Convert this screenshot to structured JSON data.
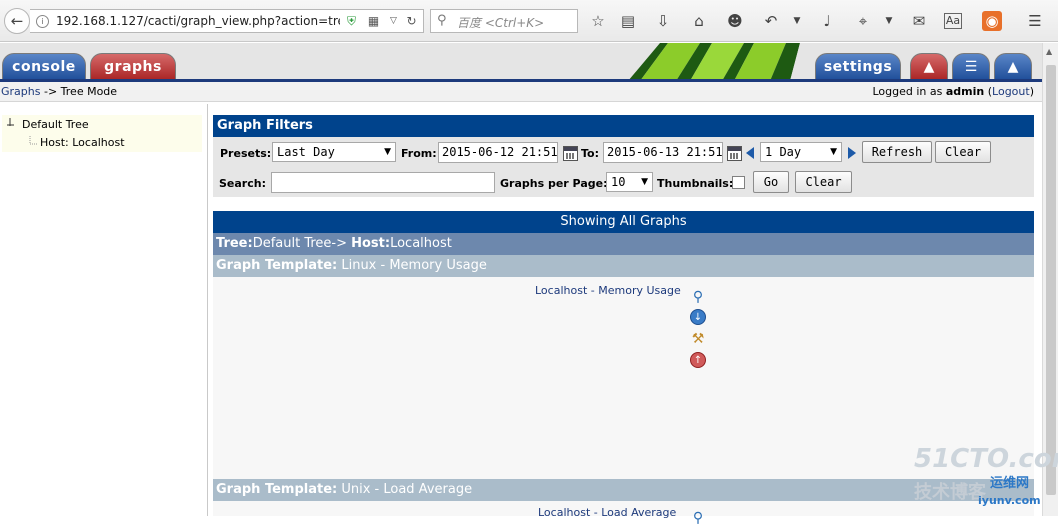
{
  "browser": {
    "url": "192.168.1.127/cacti/graph_view.php?action=tree&",
    "search_placeholder": "百度 <Ctrl+K>"
  },
  "tabs": {
    "console": "console",
    "graphs": "graphs",
    "settings": "settings"
  },
  "breadcrumb": {
    "root": "Graphs",
    "separator": " -> ",
    "current": "Tree Mode"
  },
  "login": {
    "prefix": "Logged in as ",
    "user": "admin",
    "open": " (",
    "logout": "Logout",
    "close": ")"
  },
  "tree": {
    "items": [
      {
        "label": "Default Tree"
      },
      {
        "label": "Host: Localhost"
      }
    ]
  },
  "filters": {
    "title": "Graph Filters",
    "presets_label": "Presets:",
    "presets_value": "Last Day",
    "from_label": "From:",
    "from_value": "2015-06-12 21:51",
    "to_label": "To:",
    "to_value": "2015-06-13 21:51",
    "timespan_value": "1 Day",
    "refresh": "Refresh",
    "clear": "Clear",
    "search_label": "Search:",
    "search_value": "",
    "per_page_label": "Graphs per Page:",
    "per_page_value": "10",
    "thumbnails_label": "Thumbnails:",
    "go": "Go",
    "clear2": "Clear"
  },
  "results": {
    "showing": "Showing All Graphs",
    "tree_key": "Tree:",
    "tree_value": "Default Tree",
    "host_sep": "-> ",
    "host_key": "Host:",
    "host_value": "Localhost",
    "templates": [
      {
        "key": "Graph Template:",
        "value": " Linux - Memory Usage",
        "graph_host": "Localhost",
        "graph_sep": " - ",
        "graph_name": "Memory Usage"
      },
      {
        "key": "Graph Template:",
        "value": " Unix - Load Average",
        "graph_host": "Localhost",
        "graph_sep": " - ",
        "graph_name": "Load Average"
      }
    ]
  },
  "watermark": {
    "line1": "51CTO.com",
    "line2": "技术博客",
    "line3": "运维网",
    "line4": "iyunv.com"
  },
  "colors": {
    "header_blue": "#00438c",
    "tree_row": "#6d88ad",
    "template_row": "#aabcca",
    "link": "#1d3a7c",
    "tab_red": "#a92424",
    "tab_blue": "#1f4e99"
  }
}
